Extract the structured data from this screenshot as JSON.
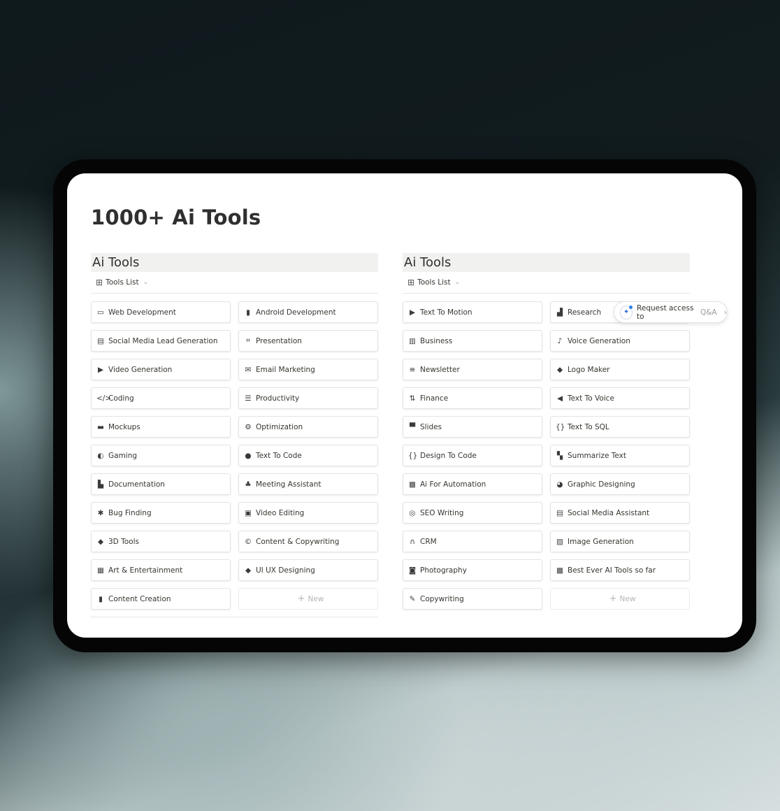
{
  "page": {
    "title": "1000+ Ai Tools"
  },
  "databases": [
    {
      "title": "Ai Tools",
      "view": {
        "icon": "gallery-grid-icon",
        "label": "Tools List"
      },
      "cards": [
        {
          "label": "Web Development",
          "icon": "browser-window-icon",
          "glyph": "▭"
        },
        {
          "label": "Android Development",
          "icon": "phone-icon",
          "glyph": "▮"
        },
        {
          "label": "Social Media Lead Generation",
          "icon": "layout-panel-icon",
          "glyph": "▤"
        },
        {
          "label": "Presentation",
          "icon": "presentation-frame-icon",
          "glyph": "⌗"
        },
        {
          "label": "Video Generation",
          "icon": "play-circle-icon",
          "glyph": "▶"
        },
        {
          "label": "Email Marketing",
          "icon": "envelope-icon",
          "glyph": "✉"
        },
        {
          "label": "Coding",
          "icon": "code-brackets-icon",
          "glyph": "</>"
        },
        {
          "label": "Productivity",
          "icon": "checklist-icon",
          "glyph": "☰"
        },
        {
          "label": "Mockups",
          "icon": "laptop-icon",
          "glyph": "▬"
        },
        {
          "label": "Optimization",
          "icon": "gear-icon",
          "glyph": "⚙"
        },
        {
          "label": "Gaming",
          "icon": "gamepad-icon",
          "glyph": "◐"
        },
        {
          "label": "Text To Code",
          "icon": "chat-bubble-icon",
          "glyph": "●"
        },
        {
          "label": "Documentation",
          "icon": "document-icon",
          "glyph": "▙"
        },
        {
          "label": "Meeting Assistant",
          "icon": "people-group-icon",
          "glyph": "♣"
        },
        {
          "label": "Bug Finding",
          "icon": "bug-icon",
          "glyph": "✱"
        },
        {
          "label": "Video Editing",
          "icon": "video-frame-icon",
          "glyph": "▣"
        },
        {
          "label": "3D Tools",
          "icon": "shapes-icon",
          "glyph": "◆"
        },
        {
          "label": "Content & Copywriting",
          "icon": "copyright-icon",
          "glyph": "©"
        },
        {
          "label": "Art & Entertainment",
          "icon": "film-icon",
          "glyph": "▦"
        },
        {
          "label": "UI UX Designing",
          "icon": "shapes-icon",
          "glyph": "◆"
        },
        {
          "label": "Content Creation",
          "icon": "phone-icon",
          "glyph": "▮"
        }
      ],
      "new_label": "New"
    },
    {
      "title": "Ai Tools",
      "view": {
        "icon": "gallery-grid-icon",
        "label": "Tools List"
      },
      "cards": [
        {
          "label": "Text To Motion",
          "icon": "play-triangle-icon",
          "glyph": "▶"
        },
        {
          "label": "Research",
          "icon": "briefcase-icon",
          "glyph": "▟"
        },
        {
          "label": "Business",
          "icon": "suitcase-icon",
          "glyph": "▥"
        },
        {
          "label": "Voice Generation",
          "icon": "microphone-icon",
          "glyph": "♪"
        },
        {
          "label": "Newsletter",
          "icon": "text-edit-icon",
          "glyph": "≡"
        },
        {
          "label": "Logo Maker",
          "icon": "shapes-icon",
          "glyph": "◆"
        },
        {
          "label": "Finance",
          "icon": "sliders-icon",
          "glyph": "⇅"
        },
        {
          "label": "Text To Voice",
          "icon": "speaker-icon",
          "glyph": "◀"
        },
        {
          "label": "Slides",
          "icon": "presentation-board-icon",
          "glyph": "▀"
        },
        {
          "label": "Text To SQL",
          "icon": "code-braces-icon",
          "glyph": "{}"
        },
        {
          "label": "Design To Code",
          "icon": "code-braces-icon",
          "glyph": "{}"
        },
        {
          "label": "Summarize Text",
          "icon": "open-book-icon",
          "glyph": "▚"
        },
        {
          "label": "Ai For Automation",
          "icon": "robot-icon",
          "glyph": "▩"
        },
        {
          "label": "Graphic Designing",
          "icon": "palette-icon",
          "glyph": "◕"
        },
        {
          "label": "SEO Writing",
          "icon": "target-icon",
          "glyph": "◎"
        },
        {
          "label": "Social Media Assistant",
          "icon": "layout-panel-icon",
          "glyph": "▤"
        },
        {
          "label": "CRM",
          "icon": "headset-icon",
          "glyph": "∩"
        },
        {
          "label": "Image Generation",
          "icon": "image-icon",
          "glyph": "▨"
        },
        {
          "label": "Photography",
          "icon": "camera-icon",
          "glyph": "◙"
        },
        {
          "label": "Best Ever AI Tools so far",
          "icon": "robot-icon",
          "glyph": "▩"
        },
        {
          "label": "Copywriting",
          "icon": "pen-icon",
          "glyph": "✎"
        }
      ],
      "new_label": "New"
    }
  ],
  "qa_pill": {
    "label": "Request access to",
    "label_suffix": "Q&A",
    "icon": "sparkle-icon"
  }
}
